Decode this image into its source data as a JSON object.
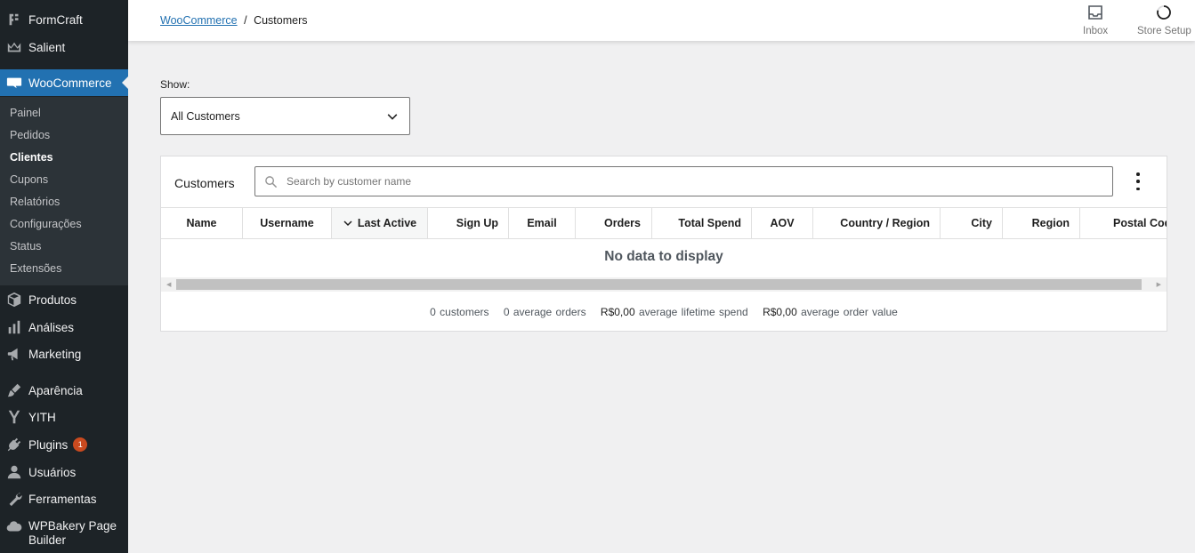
{
  "sidebar": {
    "top_items": [
      {
        "label": "FormCraft",
        "icon": "formcraft-icon"
      },
      {
        "label": "Salient",
        "icon": "salient-crown-icon"
      }
    ],
    "active": {
      "label": "WooCommerce",
      "icon": "woo-icon"
    },
    "submenu": [
      "Painel",
      "Pedidos",
      "Clientes",
      "Cupons",
      "Relatórios",
      "Configurações",
      "Status",
      "Extensões"
    ],
    "submenu_current": "Clientes",
    "bottom_items": [
      {
        "label": "Produtos",
        "icon": "products-box-icon"
      },
      {
        "label": "Análises",
        "icon": "bar-chart-icon"
      },
      {
        "label": "Marketing",
        "icon": "megaphone-icon"
      },
      {
        "label": "Aparência",
        "icon": "paintbrush-icon"
      },
      {
        "label": "YITH",
        "icon": "yith-icon"
      },
      {
        "label": "Plugins",
        "icon": "plug-icon",
        "badge": "1"
      },
      {
        "label": "Usuários",
        "icon": "user-icon"
      },
      {
        "label": "Ferramentas",
        "icon": "wrench-icon"
      },
      {
        "label": "WPBakery Page Builder",
        "icon": "wpbakery-cloud-icon"
      }
    ]
  },
  "header": {
    "breadcrumb_link": "WooCommerce",
    "breadcrumb_sep": "/",
    "breadcrumb_current": "Customers",
    "inbox_label": "Inbox",
    "store_setup_label": "Store Setup"
  },
  "filter": {
    "show_label": "Show:",
    "selected": "All Customers"
  },
  "table": {
    "title": "Customers",
    "search_placeholder": "Search by customer name",
    "columns": [
      "Name",
      "Username",
      "Last Active",
      "Sign Up",
      "Email",
      "Orders",
      "Total Spend",
      "AOV",
      "Country / Region",
      "City",
      "Region",
      "Postal Code"
    ],
    "sorted_column": "Last Active",
    "empty_message": "No data to display"
  },
  "summary": {
    "customers": "0 customers",
    "avg_orders": "0 average orders",
    "lifetime_value": "R$0,00",
    "lifetime_label": "average lifetime spend",
    "order_value": "R$0,00",
    "order_value_label": "average order value"
  },
  "colors": {
    "sidebar_bg": "#1d2327",
    "accent": "#2271b1",
    "page_bg": "#f0f0f1"
  }
}
